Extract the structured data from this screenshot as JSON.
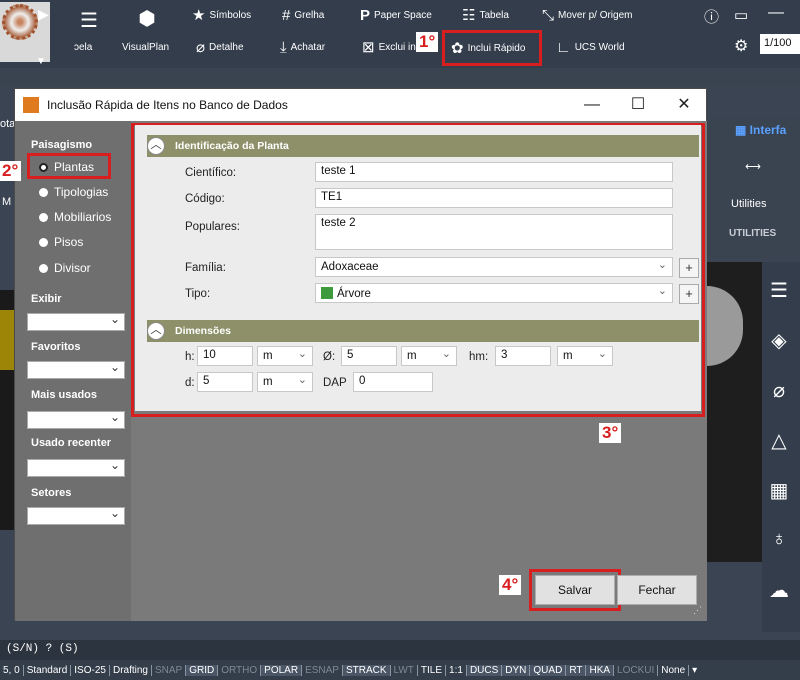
{
  "ribbon": {
    "partial_label": "ɔela",
    "visualplan": "VisualPlan",
    "simbolos": "Símbolos",
    "grelha": "Grelha",
    "paper_space": "Paper Space",
    "tabela": "Tabela",
    "mover_origem": "Mover p/ Origem",
    "detalhe": "Detalhe",
    "achatar": "Achatar",
    "exclui": "Exclui in",
    "inclui_rapido": "Inclui Rápido",
    "ucs_world": "UCS World",
    "scale": "1/100",
    "step1": "1°"
  },
  "side": {
    "interface": "Interfa",
    "utilities": "Utilities",
    "utilities_tab": "UTILITIES",
    "left_frag1": "ota",
    "left_frag2": "M"
  },
  "dialog": {
    "title": "Inclusão Rápida de Itens no Banco de Dados",
    "left": {
      "paisagismo": "Paisagismo",
      "radios": [
        "Plantas",
        "Tipologias",
        "Mobiliarios",
        "Pisos",
        "Divisor"
      ],
      "step2": "2°",
      "exibir": "Exibir",
      "favoritos": "Favoritos",
      "mais_usados": "Mais usados",
      "usado_recente": "Usado recenter",
      "setores": "Setores"
    },
    "ident": {
      "header": "Identificação da Planta",
      "cientifico_label": "Científico:",
      "cientifico": "teste 1",
      "codigo_label": "Código:",
      "codigo": "TE1",
      "populares_label": "Populares:",
      "populares": "teste 2",
      "familia_label": "Família:",
      "familia": "Adoxaceae",
      "tipo_label": "Tipo:",
      "tipo": "Árvore"
    },
    "dim": {
      "header": "Dimensões",
      "h_label": "h:",
      "h": "10",
      "h_unit": "m",
      "o_label": "Ø:",
      "o": "5",
      "o_unit": "m",
      "hm_label": "hm:",
      "hm": "3",
      "hm_unit": "m",
      "d_label": "d:",
      "d": "5",
      "d_unit": "m",
      "dap_label": "DAP",
      "dap": "0"
    },
    "step3": "3°",
    "step4": "4°",
    "salvar": "Salvar",
    "fechar": "Fechar"
  },
  "cmdline": "(S/N) ? (S)",
  "status": [
    "5, 0",
    "Standard",
    "ISO-25",
    "Drafting",
    "SNAP",
    "GRID",
    "ORTHO",
    "POLAR",
    "ESNAP",
    "STRACK",
    "LWT",
    "TILE",
    "1:1",
    "DUCS",
    "DYN",
    "QUAD",
    "RT",
    "HKA",
    "LOCKUI",
    "None"
  ],
  "colors": {
    "accent_red": "#d81e1e",
    "section_header": "#8d9069"
  }
}
